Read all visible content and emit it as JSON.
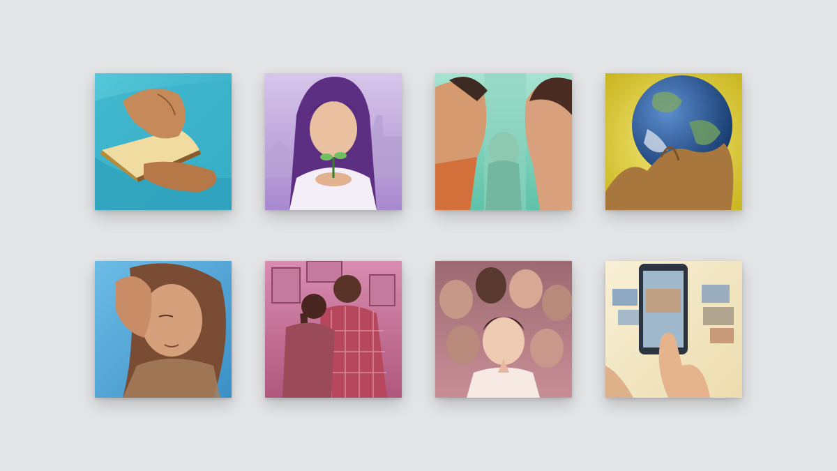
{
  "gallery": {
    "background": "#e4e5e7",
    "tiles": [
      {
        "name": "bible-reading",
        "palette": [
          "#3fbcd2",
          "#c28a5b",
          "#e8c878"
        ]
      },
      {
        "name": "girl-with-seedling",
        "palette": [
          "#b59ad6",
          "#6a3f8d",
          "#7cc36a"
        ]
      },
      {
        "name": "family-conflict",
        "palette": [
          "#6ccfb4",
          "#d89a72",
          "#4f8f84"
        ]
      },
      {
        "name": "earth-in-hands",
        "palette": [
          "#e6d14a",
          "#2f5f9f",
          "#a8773e"
        ]
      },
      {
        "name": "grieving-woman",
        "palette": [
          "#57a8dc",
          "#8e5c3a",
          "#d9a27e"
        ]
      },
      {
        "name": "embracing-couple",
        "palette": [
          "#c26b93",
          "#8a3d4a",
          "#e0a0b0"
        ]
      },
      {
        "name": "praying-group",
        "palette": [
          "#b27a86",
          "#f0c8b0",
          "#5c3a3a"
        ]
      },
      {
        "name": "phone-videos",
        "palette": [
          "#f3e7c4",
          "#2c3440",
          "#d7a07a"
        ]
      }
    ]
  }
}
